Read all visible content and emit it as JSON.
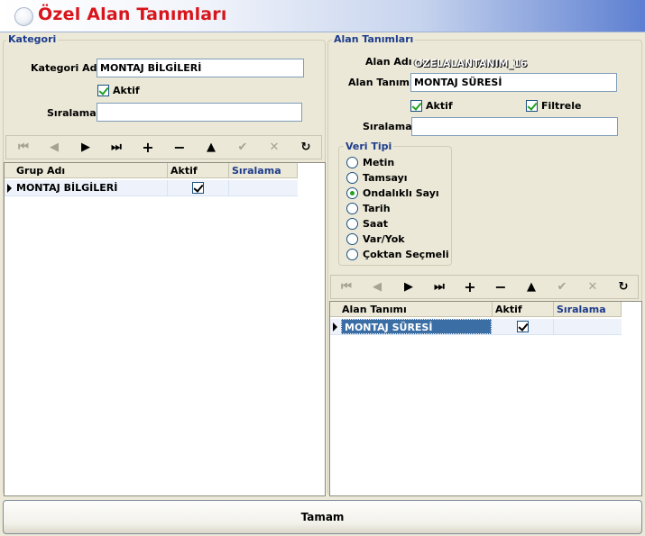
{
  "window": {
    "title": "Özel Alan Tanımları"
  },
  "kategori": {
    "group_title": "Kategori",
    "ad_label": "Kategori Adı",
    "ad_value": "MONTAJ BİLGİLERİ",
    "aktif_label": "Aktif",
    "aktif_checked": true,
    "siralama_label": "Sıralama",
    "siralama_value": "",
    "navigator": [
      "first-icon",
      "prior-icon",
      "next-icon",
      "last-icon",
      "insert-icon",
      "delete-icon",
      "edit-icon",
      "post-icon",
      "cancel-icon",
      "refresh-icon"
    ],
    "grid": {
      "columns": [
        "Grup Adı",
        "Aktif",
        "Sıralama"
      ],
      "rows": [
        {
          "grup_adi": "MONTAJ BİLGİLERİ",
          "aktif": true,
          "siralama": ""
        }
      ]
    }
  },
  "alan": {
    "group_title": "Alan Tanımları",
    "alan_adi_label": "Alan Adı",
    "alan_adi_value": "OZELALANTANIM_16",
    "alan_tanimi_label": "Alan Tanımı",
    "alan_tanimi_value": "MONTAJ SÜRESİ",
    "aktif_label": "Aktif",
    "aktif_checked": true,
    "filtrele_label": "Filtrele",
    "filtrele_checked": true,
    "siralama_label": "Sıralama",
    "siralama_value": "",
    "veri_tipi": {
      "title": "Veri Tipi",
      "options": [
        "Metin",
        "Tamsayı",
        "Ondalıklı Sayı",
        "Tarih",
        "Saat",
        "Var/Yok",
        "Çoktan Seçmeli"
      ],
      "selected": "Ondalıklı Sayı"
    },
    "grid": {
      "columns": [
        "Alan Tanımı",
        "Aktif",
        "Sıralama"
      ],
      "rows": [
        {
          "alan_tanimi": "MONTAJ SÜRESİ",
          "aktif": true,
          "siralama": ""
        }
      ]
    }
  },
  "footer": {
    "ok_label": "Tamam"
  }
}
